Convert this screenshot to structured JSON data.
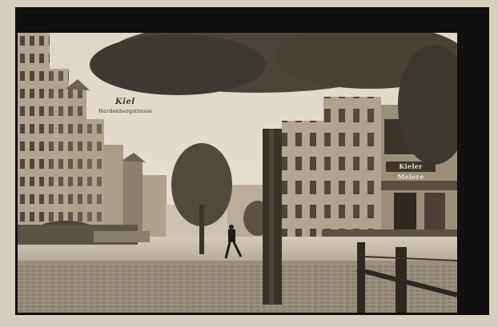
{
  "postcard": {
    "title": "Kiel",
    "subtitle": "Hardenbergstrasse",
    "shop_sign": "Kieler Meiere",
    "style": "sepia photographic postcard",
    "colors": {
      "border": "#101010",
      "sky": "#e2dccf",
      "building_light": "#b9ad99",
      "building_dark": "#5d5145",
      "foliage": "#3f3a31",
      "street": "#c9bfae"
    }
  }
}
